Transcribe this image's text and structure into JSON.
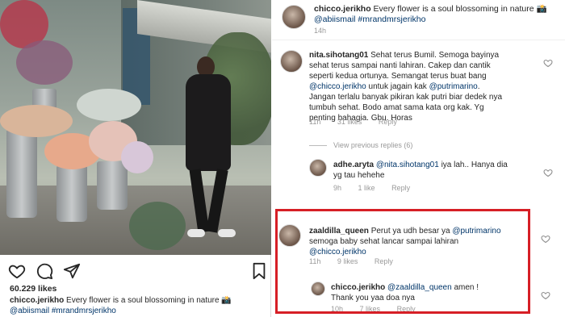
{
  "post": {
    "likes": "60.229 likes",
    "caption_user": "chicco.jerikho",
    "caption_text": " Every flower is a soul blossoming in nature 📸",
    "caption_tags": "@abiismail #mrandmrsjerikho",
    "icons": [
      "heart-icon",
      "comment-icon",
      "share-icon",
      "bookmark-icon"
    ]
  },
  "header": {
    "user": "chicco.jerikho",
    "text": " Every flower is a soul blossoming in nature 📸",
    "tags": "@abiismail #mrandmrsjerikho",
    "time": "14h"
  },
  "comments": [
    {
      "user": "nita.sihotang01",
      "text_lines": [
        "Sehat terus Bumil. Semoga bayinya",
        "sehat terus sampai nanti lahiran. Cakep dan cantik",
        "seperti kedua ortunya. Semangat terus buat bang",
        "|@chicco.jerikho| untuk jagain kak |@putrimarino|.",
        "Jangan terlalu banyak pikiran kak putri biar dedek nya",
        "tumbuh sehat. Bodo amat sama kata org kak. Yg",
        "penting bahagia. Gbu. Horas"
      ],
      "time": "11h",
      "likes": "31 likes",
      "reply": "Reply"
    },
    {
      "user": "adhe.aryta",
      "mention": "@nita.sihotang01",
      "text_a": " iya lah.. Hanya dia",
      "text_b": "yg tau hehehe",
      "time": "9h",
      "likes": "1 like",
      "reply": "Reply"
    },
    {
      "user": "zaaldilla_queen",
      "text_a": " Perut ya udh besar ya ",
      "mention_a": "@putrimarino",
      "text_b": "semoga baby sehat lancar sampai lahiran",
      "mention_b": "@chicco.jerikho",
      "time": "11h",
      "likes": "9 likes",
      "reply": "Reply"
    },
    {
      "user": "chicco.jerikho",
      "mention": "@zaaldilla_queen",
      "text_a": " amen !",
      "text_b": "Thank you yaa doa nya",
      "time": "10h",
      "likes": "7 likes",
      "reply": "Reply"
    }
  ],
  "view_replies": "View previous replies (6)",
  "colors": {
    "highlight": "#d61f26",
    "mention": "#003569",
    "meta": "#999999"
  }
}
